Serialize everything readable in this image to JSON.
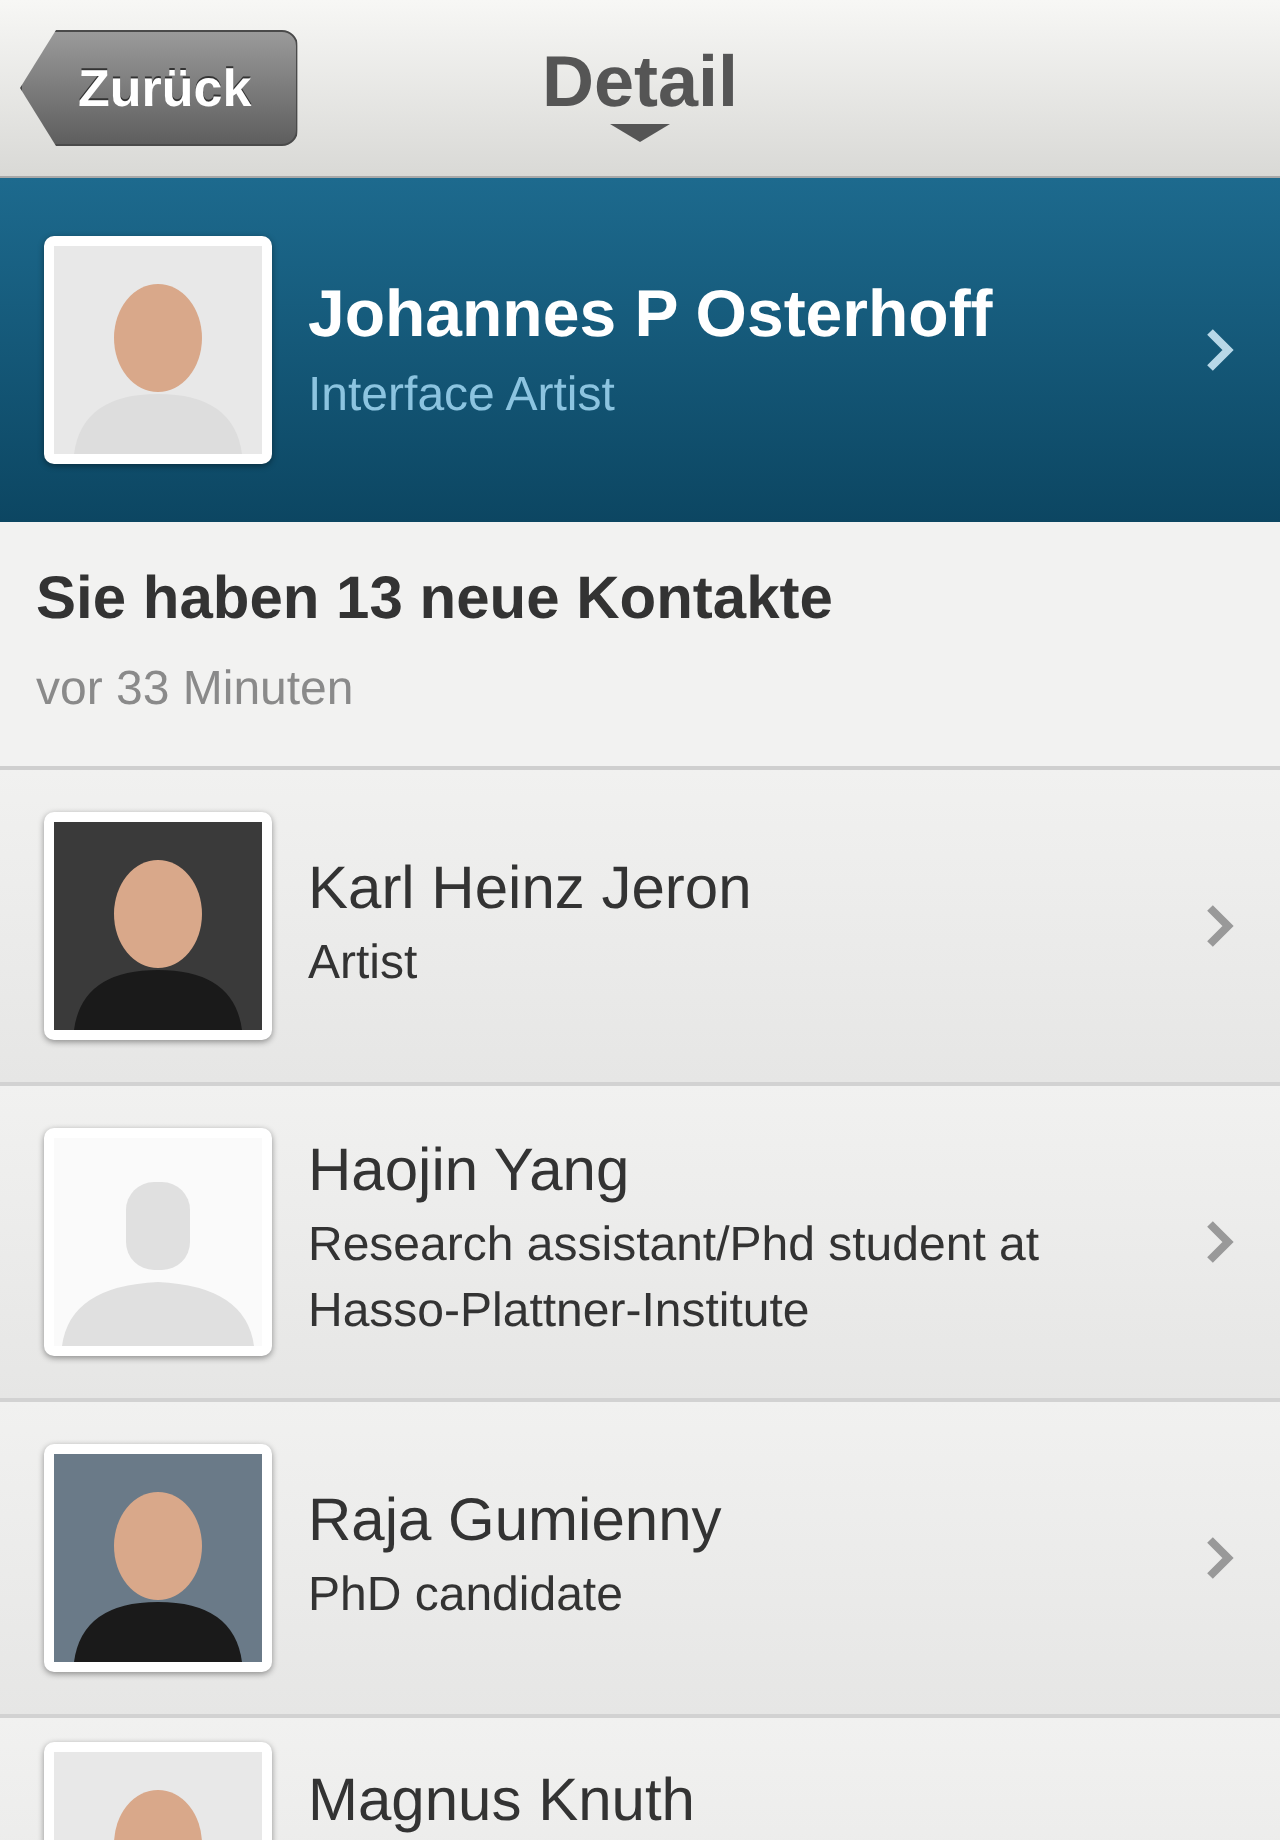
{
  "nav_bar": {
    "back_button": "Zurück",
    "title": "Detail"
  },
  "profile": {
    "name": "Johannes P Osterhoff",
    "subtitle": "Interface Artist"
  },
  "notification": {
    "title": "Sie haben 13 neue Kontakte",
    "time": "vor 33 Minuten"
  },
  "contacts": [
    {
      "name": "Karl Heinz Jeron",
      "subtitle": "Artist"
    },
    {
      "name": "Haojin Yang",
      "subtitle": "Research assistant/Phd student at Hasso-Plattner-Institute",
      "kind": "placeholder"
    },
    {
      "name": "Raja Gumienny",
      "subtitle": "PhD candidate"
    },
    {
      "name": "Magnus Knuth"
    }
  ]
}
